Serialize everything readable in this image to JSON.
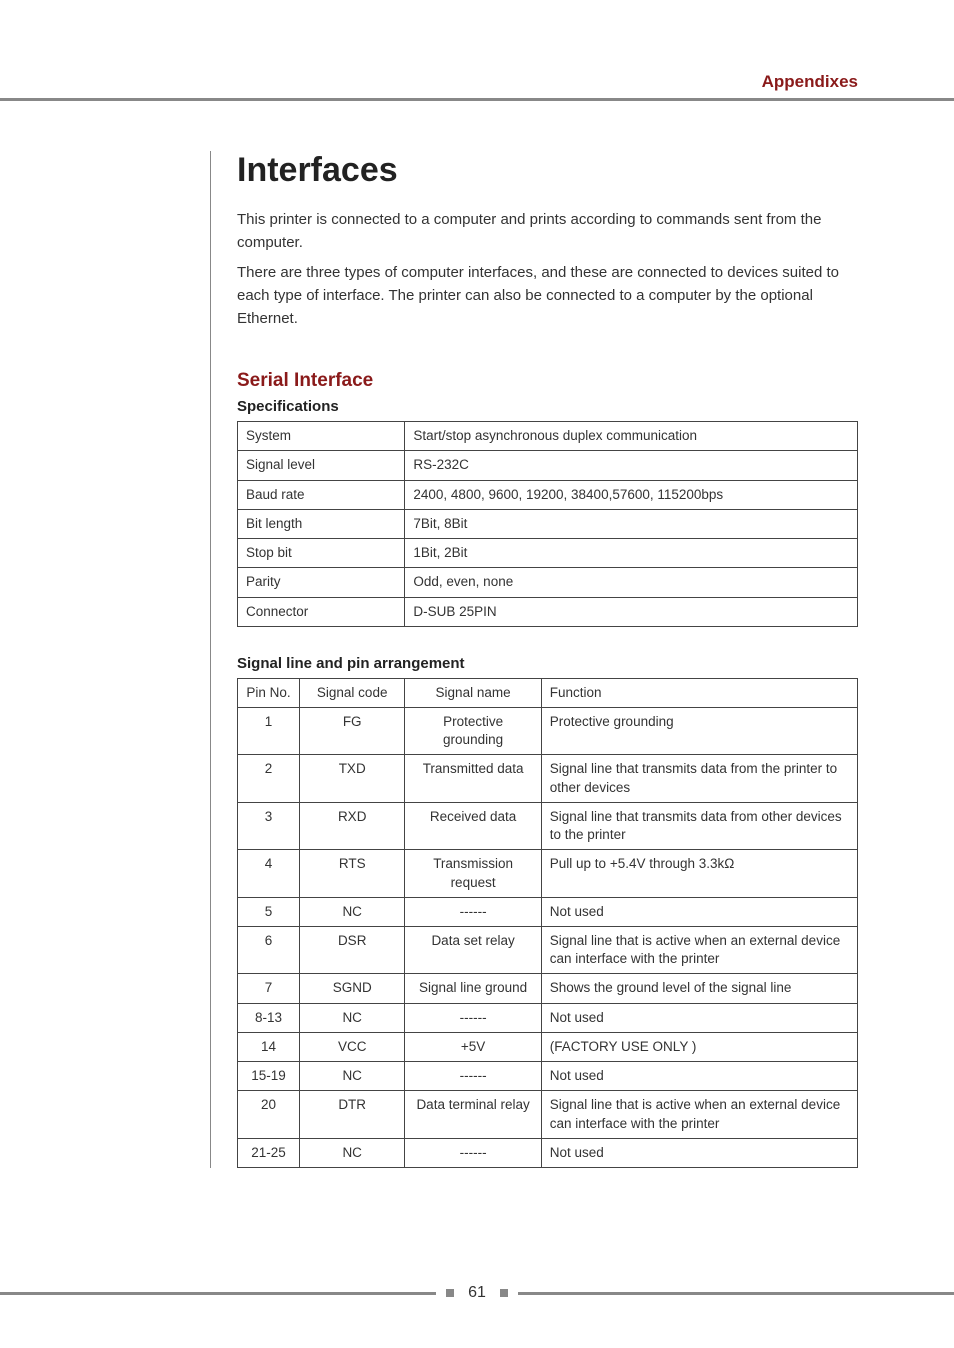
{
  "header": {
    "running_head": "Appendixes"
  },
  "title": "Interfaces",
  "intro": {
    "p1": "This printer is connected to a computer and prints according to commands sent from the computer.",
    "p2": "There are three types of computer interfaces, and these are connected to devices suited to each type of interface. The printer can also be connected to a computer by the optional Ethernet."
  },
  "serial": {
    "title": "Serial Interface",
    "spec_heading": "Specifications",
    "specs": [
      {
        "k": "System",
        "v": "Start/stop asynchronous duplex communication"
      },
      {
        "k": "Signal level",
        "v": "RS-232C"
      },
      {
        "k": "Baud rate",
        "v": "2400, 4800, 9600, 19200, 38400,57600, 115200bps"
      },
      {
        "k": "Bit length",
        "v": "7Bit, 8Bit"
      },
      {
        "k": "Stop bit",
        "v": "1Bit, 2Bit"
      },
      {
        "k": "Parity",
        "v": "Odd, even, none"
      },
      {
        "k": "Connector",
        "v": "D-SUB 25PIN"
      }
    ],
    "pin_heading": "Signal line and pin arrangement",
    "pin_headers": {
      "c0": "Pin No.",
      "c1": "Signal code",
      "c2": "Signal name",
      "c3": "Function"
    },
    "pins": [
      {
        "no": "1",
        "code": "FG",
        "name": "Protective grounding",
        "func": "Protective grounding"
      },
      {
        "no": "2",
        "code": "TXD",
        "name": "Transmitted data",
        "func": "Signal line that transmits data from the printer to other devices"
      },
      {
        "no": "3",
        "code": "RXD",
        "name": "Received data",
        "func": "Signal line that transmits data from other devices to the printer"
      },
      {
        "no": "4",
        "code": "RTS",
        "name": "Transmission request",
        "func": "Pull up to +5.4V through 3.3kΩ"
      },
      {
        "no": "5",
        "code": "NC",
        "name": "------",
        "func": "Not used"
      },
      {
        "no": "6",
        "code": "DSR",
        "name": "Data set relay",
        "func": "Signal line that is active when an external device can interface with the printer"
      },
      {
        "no": "7",
        "code": "SGND",
        "name": "Signal line ground",
        "func": "Shows the ground level of the signal line"
      },
      {
        "no": "8-13",
        "code": "NC",
        "name": "------",
        "func": "Not used"
      },
      {
        "no": "14",
        "code": "VCC",
        "name": "+5V",
        "func": "(FACTORY USE ONLY )"
      },
      {
        "no": "15-19",
        "code": "NC",
        "name": "------",
        "func": "Not used"
      },
      {
        "no": "20",
        "code": "DTR",
        "name": "Data terminal relay",
        "func": "Signal line that is active when an external device can interface with the printer"
      },
      {
        "no": "21-25",
        "code": "NC",
        "name": "------",
        "func": "Not used"
      }
    ]
  },
  "page_number": "61"
}
